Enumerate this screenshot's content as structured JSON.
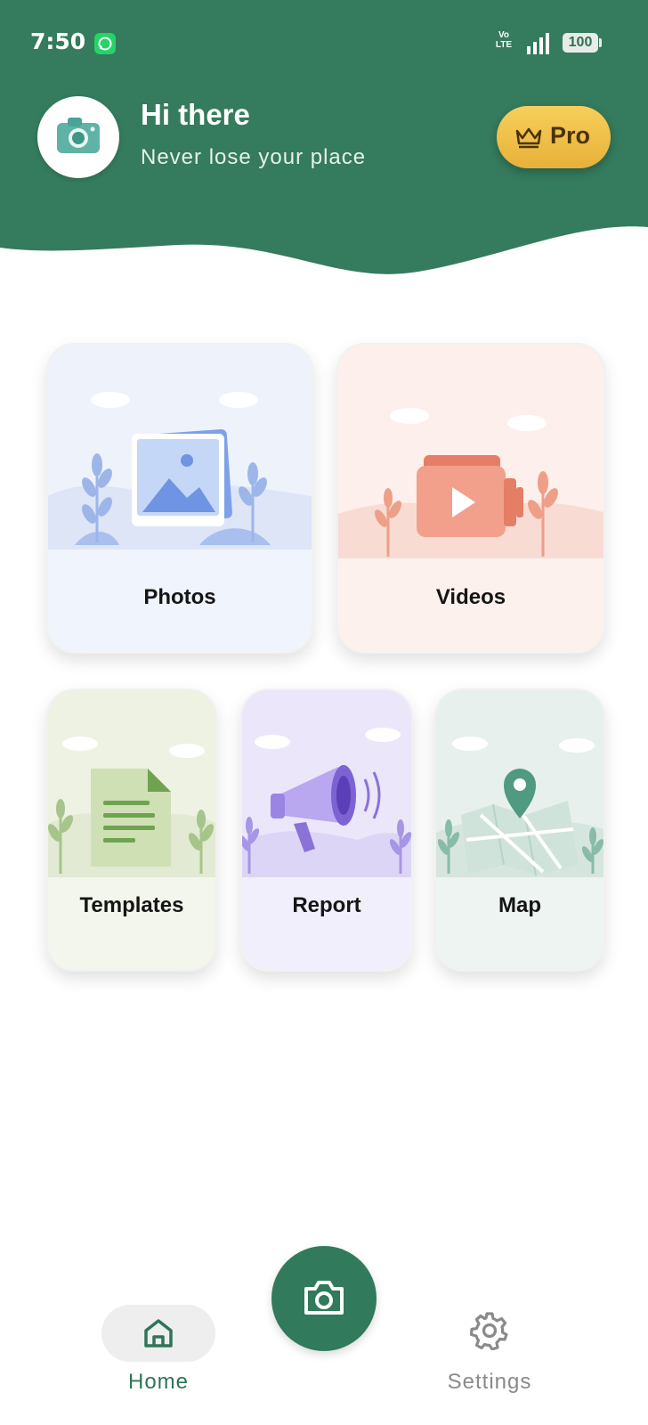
{
  "status_bar": {
    "time": "7:50",
    "network": "Vo LTE",
    "battery": "100",
    "icons": [
      "whatsapp-icon",
      "signal-icon",
      "battery-icon"
    ]
  },
  "header": {
    "greeting": "Hi there",
    "subtitle": "Never lose your place",
    "pro_label": "Pro",
    "colors": {
      "background": "#357b5d",
      "pro_button": "#f0c24a"
    }
  },
  "cards": {
    "photos": "Photos",
    "videos": "Videos",
    "templates": "Templates",
    "report": "Report",
    "map": "Map"
  },
  "bottom_nav": {
    "home_label": "Home",
    "settings_label": "Settings",
    "icons": [
      "home-icon",
      "camera-icon",
      "gear-icon"
    ],
    "active": "Home"
  }
}
